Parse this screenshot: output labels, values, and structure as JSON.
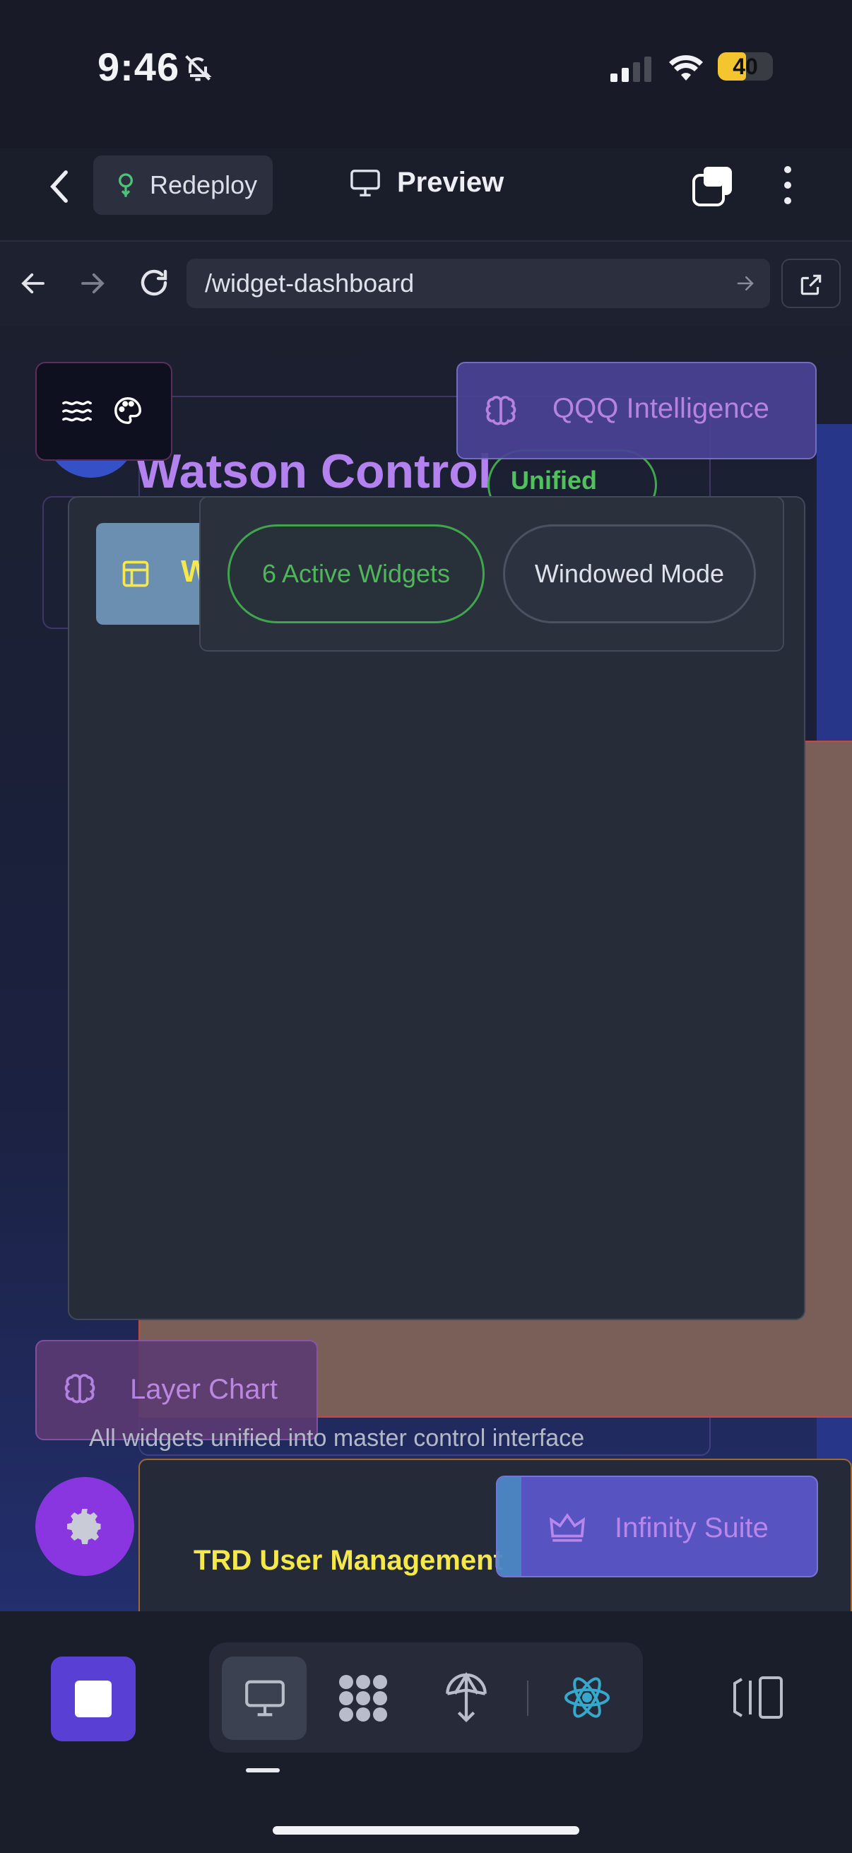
{
  "status_bar": {
    "time": "9:46",
    "battery": "40"
  },
  "header": {
    "redeploy_label": "Redeploy",
    "preview_label": "Preview"
  },
  "browser": {
    "url": "/widget-dashboard"
  },
  "dashboard": {
    "title": "Watson Control",
    "badge": "Unified",
    "w_button_initial": "W",
    "active_widgets_label": "6 Active Widgets",
    "windowed_mode_label": "Windowed Mode",
    "qqq_card_label": "QQQ Intelligence",
    "layer_chart_label": "Layer Chart",
    "subtitle": "All widgets unified into master control interface",
    "trd_label": "TRD User Management",
    "infinity_label": "Infinity Suite"
  },
  "colors": {
    "accent_purple": "#b382ee",
    "accent_green": "#4fb65a",
    "accent_yellow": "#f5e84a",
    "stop_button": "#5a3fd4",
    "gear_fab": "#8a36e0"
  },
  "icons": [
    "bell-off-icon",
    "signal-icon",
    "wifi-icon",
    "battery-icon",
    "back-chevron-icon",
    "deploy-tree-icon",
    "monitor-icon",
    "tabs-icon",
    "kebab-icon",
    "arrow-left-icon",
    "arrow-right-icon",
    "reload-icon",
    "go-arrow-icon",
    "external-link-icon",
    "waves-icon",
    "palette-icon",
    "brain-icon",
    "layout-icon",
    "gear-icon",
    "crown-icon",
    "stop-icon",
    "desktop-icon",
    "components-icon",
    "deploy-icon",
    "react-icon",
    "panel-toggle-icon"
  ]
}
